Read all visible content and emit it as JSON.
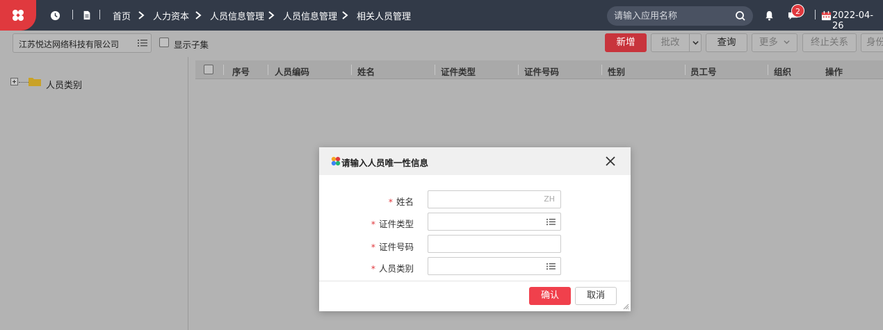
{
  "header": {
    "breadcrumbs": [
      "首页",
      "人力资本",
      "人员信息管理",
      "人员信息管理",
      "相关人员管理"
    ],
    "search_placeholder": "请输入应用名称",
    "notification_count": "2",
    "date": "2022-04-26"
  },
  "toolbar": {
    "org_name": "江苏悦达网络科技有限公司",
    "show_subset_label": "显示子集",
    "buttons": {
      "add": "新增",
      "batch_edit": "批改",
      "query": "查询",
      "more": "更多",
      "terminate": "终止关系",
      "identity": "身份"
    }
  },
  "tree": {
    "root_label": "人员类别"
  },
  "table": {
    "columns": [
      "序号",
      "人员编码",
      "姓名",
      "证件类型",
      "证件号码",
      "性别",
      "员工号",
      "组织",
      "操作"
    ]
  },
  "modal": {
    "title": "请输入人员唯一性信息",
    "fields": [
      {
        "label": "姓名",
        "required": true,
        "suffix": "ZH"
      },
      {
        "label": "证件类型",
        "required": true
      },
      {
        "label": "证件号码",
        "required": true
      },
      {
        "label": "人员类别",
        "required": true
      }
    ],
    "required_mark": "*",
    "confirm_label": "确认",
    "cancel_label": "取消"
  },
  "colors": {
    "topbar_bg": "#323a48",
    "brand_red": "#e0393e",
    "primary_button": "#f0404c"
  }
}
